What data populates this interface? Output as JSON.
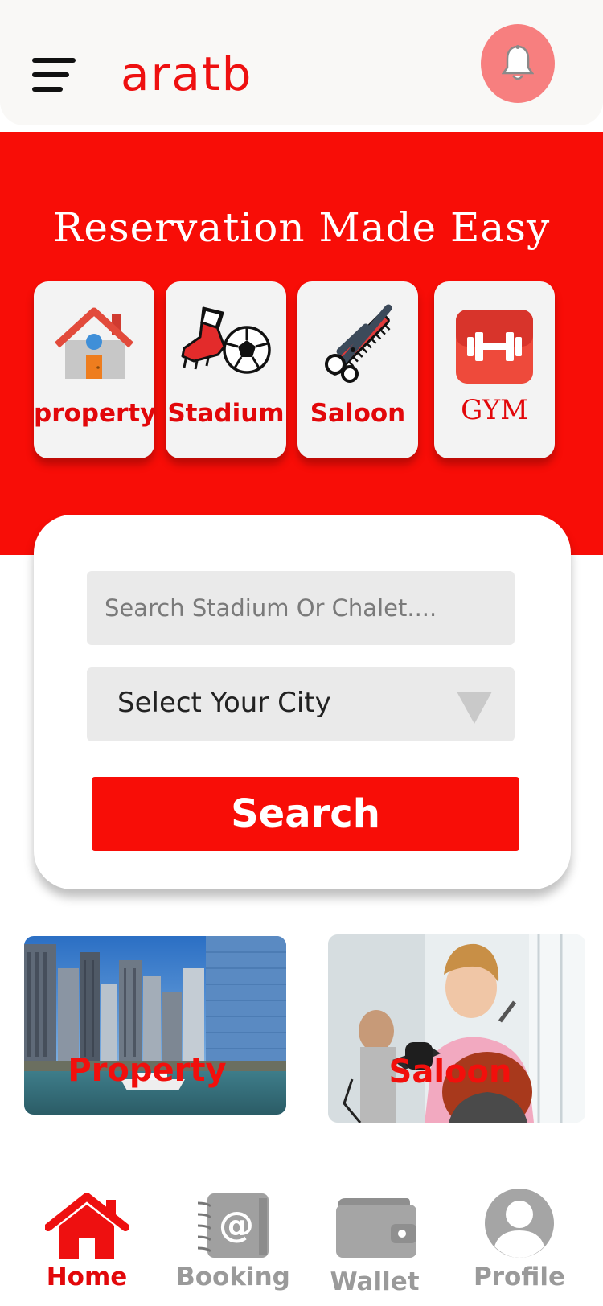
{
  "header": {
    "logo_text": "aratb"
  },
  "hero": {
    "title": "Reservation Made Easy",
    "categories": [
      {
        "label": "property",
        "icon": "house-icon"
      },
      {
        "label": "Stadium",
        "icon": "soccer-boot-ball-icon"
      },
      {
        "label": "Saloon",
        "icon": "scissors-comb-icon"
      },
      {
        "label": "GYM",
        "icon": "dumbbell-icon"
      }
    ]
  },
  "search": {
    "placeholder": "Search Stadium Or Chalet....",
    "city_select": "Select Your City",
    "button_label": "Search"
  },
  "features": [
    {
      "label": "Property"
    },
    {
      "label": "Saloon"
    }
  ],
  "nav": {
    "items": [
      {
        "label": "Home",
        "icon": "home-icon",
        "active": true
      },
      {
        "label": "Booking",
        "icon": "address-book-icon",
        "active": false
      },
      {
        "label": "Wallet",
        "icon": "wallet-icon",
        "active": false
      },
      {
        "label": "Profile",
        "icon": "user-icon",
        "active": false
      }
    ]
  },
  "colors": {
    "brand_red": "#f80d07",
    "bell_bg": "#f77f7f",
    "inactive_gray": "#9a9a9a"
  }
}
